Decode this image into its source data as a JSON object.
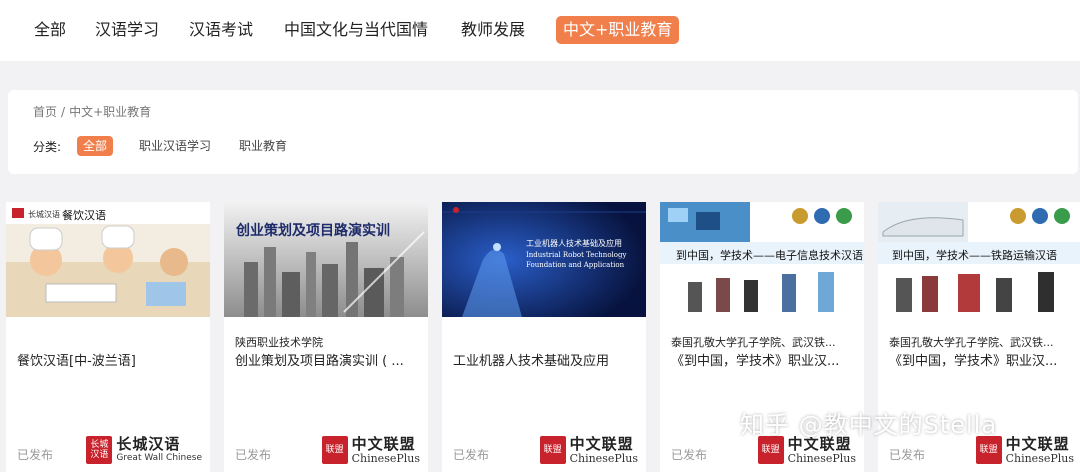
{
  "nav": {
    "items": [
      "全部",
      "汉语学习",
      "汉语考试",
      "中国文化与当代国情",
      "教师发展",
      "中文+职业教育"
    ],
    "active_index": 5
  },
  "breadcrumb": {
    "home": "首页",
    "sep": "/",
    "current": "中文+职业教育"
  },
  "filter": {
    "label": "分类:",
    "categories": [
      "全部",
      "职业汉语学习",
      "职业教育"
    ],
    "active_index": 0
  },
  "cards": [
    {
      "thumb_caption": "餐饮汉语",
      "thumb_brand": "长城汉语",
      "line1": "",
      "line2": "餐饮汉语[中-波兰语]",
      "status": "已发布",
      "publisher_cn": "长城汉语",
      "publisher_en": "Great Wall Chinese",
      "seal": "长城\n汉语"
    },
    {
      "thumb_caption": "创业策划及项目路演实训",
      "line1": "陕西职业技术学院",
      "line2": "创业策划及项目路演实训 ( ...",
      "status": "已发布",
      "publisher_cn": "中文联盟",
      "publisher_en": "ChinesePlus",
      "seal": "联盟"
    },
    {
      "thumb_caption": "工业机器人技术基础及应用",
      "thumb_caption_en": "Industrial Robot Technology Foundation and Application",
      "line1": "",
      "line2": "工业机器人技术基础及应用",
      "status": "已发布",
      "publisher_cn": "中文联盟",
      "publisher_en": "ChinesePlus",
      "seal": "联盟"
    },
    {
      "thumb_caption": "到中国，学技术——电子信息技术汉语",
      "line1": "泰国孔敬大学孔子学院、武汉铁...",
      "line2": "《到中国，学技术》职业汉...",
      "status": "已发布",
      "publisher_cn": "中文联盟",
      "publisher_en": "ChinesePlus",
      "seal": "联盟"
    },
    {
      "thumb_caption": "到中国，学技术——铁路运输汉语",
      "line1": "泰国孔敬大学孔子学院、武汉铁...",
      "line2": "《到中国，学技术》职业汉...",
      "status": "已发布",
      "publisher_cn": "中文联盟",
      "publisher_en": "ChinesePlus",
      "seal": "联盟"
    }
  ],
  "watermark": "知乎 @教中文的Stella",
  "colors": {
    "accent": "#f07f4b",
    "seal": "#c8232c",
    "page_bg": "#f2f2f4"
  }
}
